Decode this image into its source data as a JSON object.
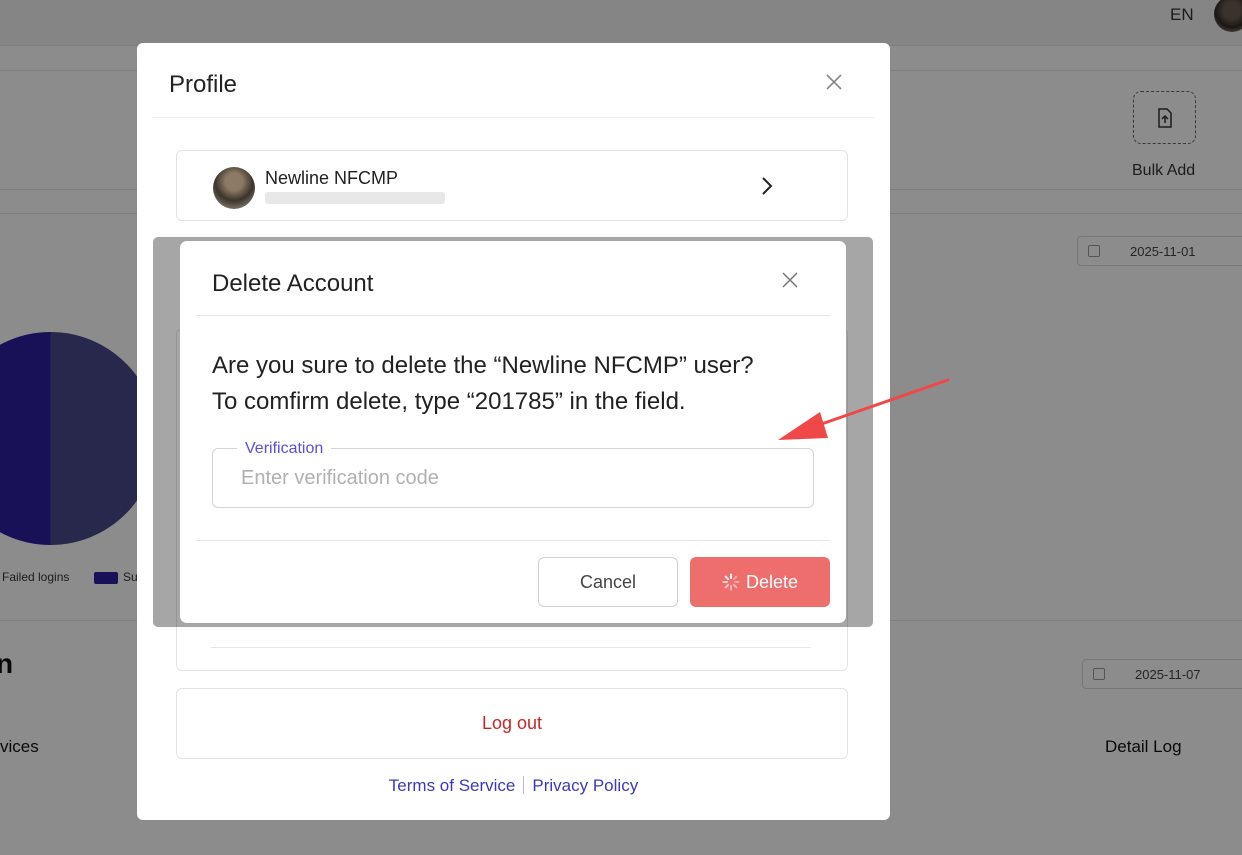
{
  "topbar": {
    "language": "EN"
  },
  "background": {
    "bulk_add_label": "Bulk Add",
    "date_top": "2025-11-01",
    "date_bottom": "2025-11-07",
    "legend_failed": "Failed logins",
    "legend_success_partial": "Su",
    "section_heading_partial": "n",
    "tab_partial": "vices",
    "detail_log": "Detail Log",
    "colors": {
      "pie_primary": "#2d1fa0",
      "pie_secondary": "#4a4a8a"
    }
  },
  "profile": {
    "title": "Profile",
    "user_name": "Newline NFCMP",
    "logout_label": "Log out",
    "terms_label": "Terms of Service",
    "privacy_label": "Privacy Policy"
  },
  "dialog": {
    "title": "Delete Account",
    "message_line1": "Are you sure to delete the “Newline NFCMP” user?",
    "message_line2": "To comfirm delete, type “201785” in the field.",
    "verification_label": "Verification",
    "verification_placeholder": "Enter verification code",
    "verification_value": "",
    "cancel_label": "Cancel",
    "delete_label": "Delete",
    "colors": {
      "accent": "#5b4fd6",
      "danger": "#ee6e6e",
      "annotation_arrow": "#f04848"
    }
  },
  "icons": {
    "profile_close": "close-icon",
    "dialog_close": "close-icon",
    "user_chevron": "chevron-right-icon",
    "delete_spinner": "spinner-icon",
    "bulk_add": "file-upload-icon",
    "date": "calendar-icon"
  }
}
